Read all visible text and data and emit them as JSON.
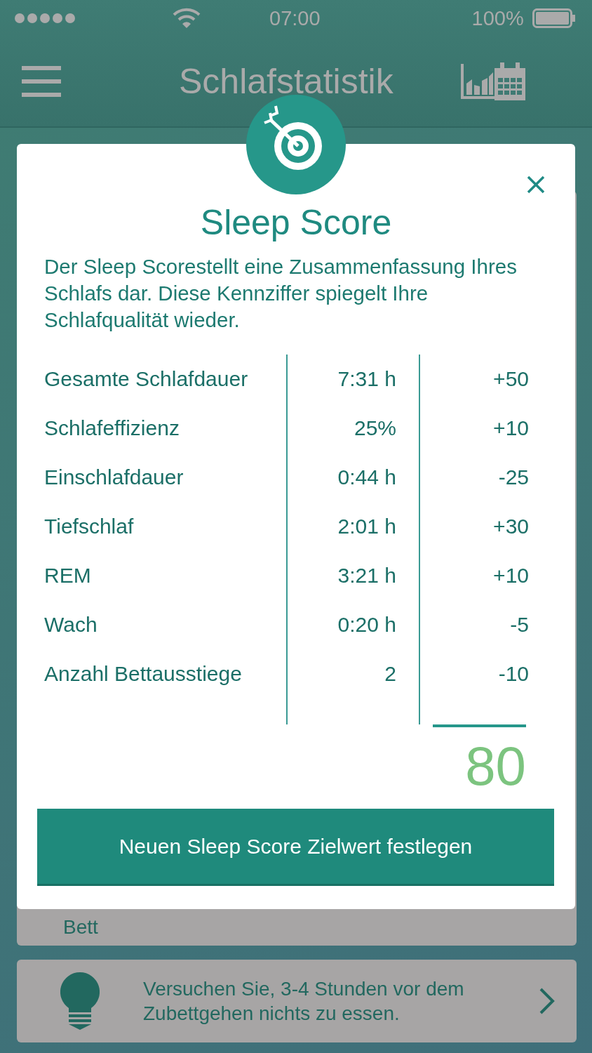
{
  "status_bar": {
    "time": "07:00",
    "battery": "100%"
  },
  "header": {
    "title": "Schlafstatistik"
  },
  "modal": {
    "title": "Sleep Score",
    "description": "Der Sleep Scorestellt eine Zusammenfassung Ihres Schlafs dar. Diese Kennziffer spiegelt Ihre Schlafqualität wieder.",
    "rows": [
      {
        "label": "Gesamte Schlafdauer",
        "value": "7:31 h",
        "points": "+50"
      },
      {
        "label": "Schlafeffizienz",
        "value": "25%",
        "points": "+10"
      },
      {
        "label": "Einschlafdauer",
        "value": "0:44 h",
        "points": "-25"
      },
      {
        "label": "Tiefschlaf",
        "value": "2:01 h",
        "points": "+30"
      },
      {
        "label": "REM",
        "value": "3:21 h",
        "points": "+10"
      },
      {
        "label": "Wach",
        "value": "0:20 h",
        "points": "-5"
      },
      {
        "label": "Anzahl Bettausstiege",
        "value": "2",
        "points": "-10"
      }
    ],
    "total": "80",
    "button": "Neuen Sleep Score Zielwert festlegen"
  },
  "background": {
    "card_label": "Bett",
    "tip": "Versuchen Sie, 3-4 Stunden vor dem Zubettgehen nichts zu essen."
  }
}
